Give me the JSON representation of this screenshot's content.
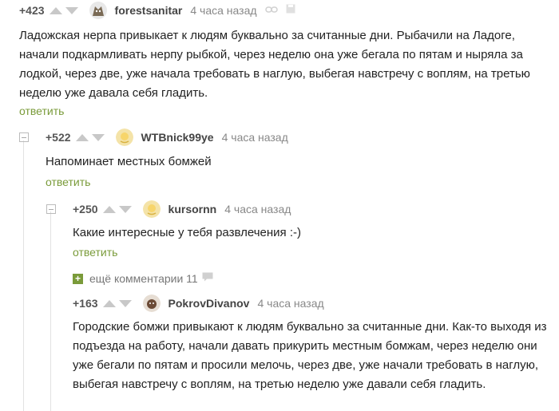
{
  "comments": [
    {
      "rating": "+423",
      "username": "forestsanitar",
      "time": "4 часа назад",
      "text": "Ладожская нерпа привыкает к людям буквально за считанные дни. Рыбачили на Ладоге, начали подкармливать нерпу рыбкой, через неделю она уже бегала по пятам и ныряла за лодкой, через две, уже начала требовать в наглую, выбегая навстречу с воплям, на третью неделю уже давала себя гладить.",
      "reply": "ответить"
    },
    {
      "rating": "+522",
      "username": "WTBnick99ye",
      "time": "4 часа назад",
      "text": "Напоминает местных бомжей",
      "reply": "ответить"
    },
    {
      "rating": "+250",
      "username": "kursornn",
      "time": "4 часа назад",
      "text": "Какие интересные у тебя развлечения :-)",
      "reply": "ответить"
    },
    {
      "rating": "+163",
      "username": "PokrovDivanov",
      "time": "4 часа назад",
      "text": "Городские бомжи привыкают к людям буквально за считанные дни. Как-то выходя из подъезда на работу, начали давать прикурить местным бомжам, через неделю они уже бегали по пятам и просили мелочь, через две, уже начали требовать в наглую, выбегая навстречу с воплям, на третью неделю уже давали себя гладить."
    }
  ],
  "more_comments": {
    "label": "ещё комментарии 11"
  },
  "colors": {
    "accent": "#7a9b3a",
    "meta": "#888888"
  }
}
